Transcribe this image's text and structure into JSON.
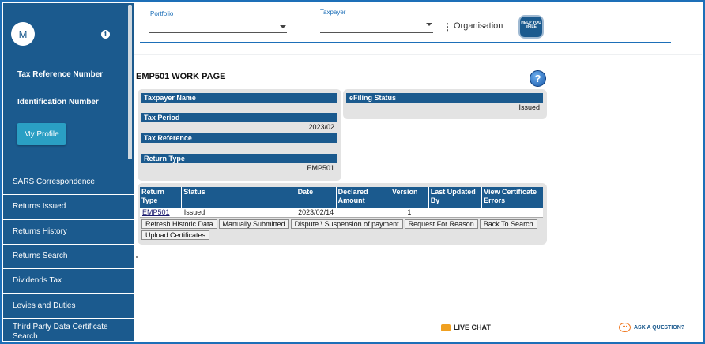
{
  "sidebar": {
    "avatar_initial": "M",
    "tax_reference_label": "Tax Reference Number",
    "identification_label": "Identification Number",
    "my_profile_button": "My Profile",
    "menu": [
      "SARS Correspondence",
      "Returns Issued",
      "Returns History",
      "Returns Search",
      "Dividends Tax",
      "Levies and Duties",
      "Third Party Data Certificate Search"
    ]
  },
  "topbar": {
    "portfolio_label": "Portfolio",
    "taxpayer_label": "Taxpayer",
    "organisation_label": "Organisation",
    "help_logo_text": "HELP YOU eFILE"
  },
  "page": {
    "title": "EMP501 WORK PAGE",
    "help_icon": "?"
  },
  "details": {
    "taxpayer_name_label": "Taxpayer Name",
    "taxpayer_name_value": "",
    "tax_period_label": "Tax Period",
    "tax_period_value": "2023/02",
    "tax_reference_label": "Tax Reference",
    "tax_reference_value": "",
    "return_type_label": "Return Type",
    "return_type_value": "EMP501"
  },
  "efiling": {
    "status_label": "eFiling Status",
    "status_value": "Issued"
  },
  "returns_table": {
    "headers": [
      "Return Type",
      "Status",
      "Date",
      "Declared Amount",
      "Version",
      "Last Updated By",
      "View Certificate Errors"
    ],
    "rows": [
      {
        "return_type": "EMP501",
        "status": "Issued",
        "date": "2023/02/14",
        "declared_amount": "",
        "version": "1",
        "last_updated_by": "",
        "view_errors": ""
      }
    ]
  },
  "actions": {
    "refresh": "Refresh Historic Data",
    "manually_submitted": "Manually Submitted",
    "dispute": "Dispute \\ Suspension of payment",
    "request_reason": "Request For Reason",
    "back": "Back To Search",
    "upload": "Upload Certificates"
  },
  "footer": {
    "live_chat": "LIVE CHAT",
    "ask_question": "ASK A QUESTION?"
  },
  "colors": {
    "navy": "#1b5a8e",
    "accent": "#2a9fc4",
    "panel": "#e3e3e3"
  }
}
